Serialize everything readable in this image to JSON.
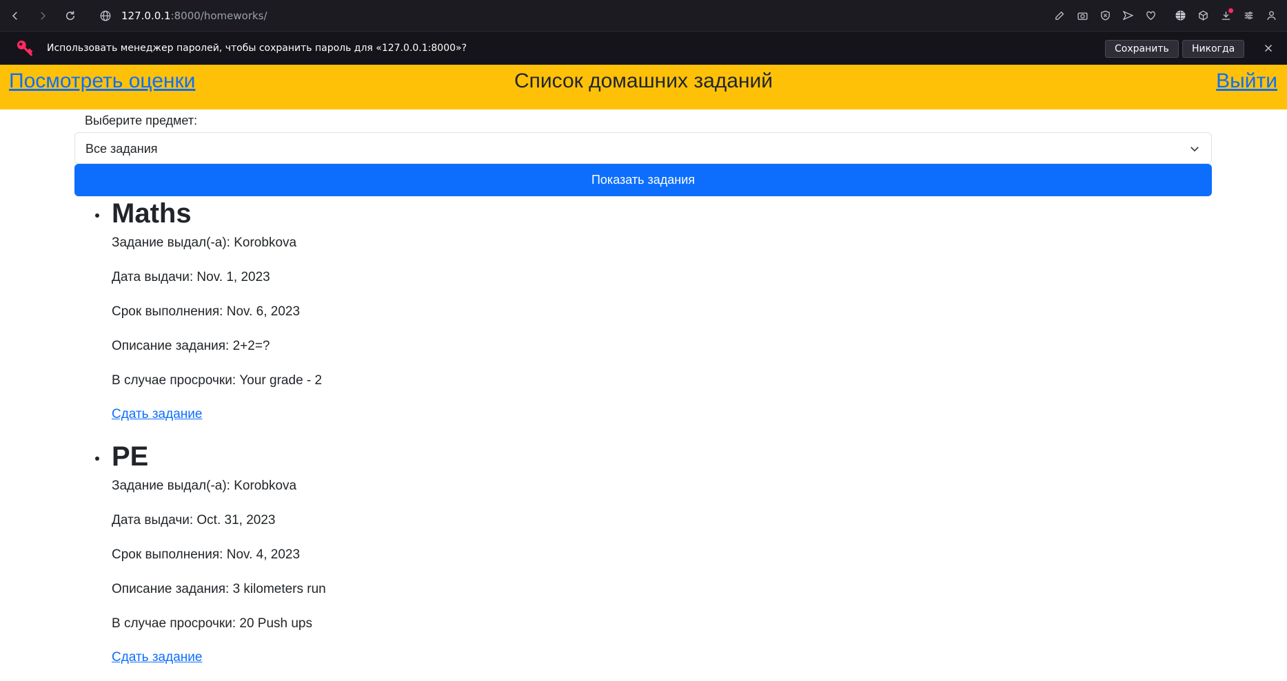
{
  "browser": {
    "url_host": "127.0.0.1",
    "url_rest": ":8000/homeworks/"
  },
  "password_bar": {
    "message": "Использовать менеджер паролей, чтобы сохранить пароль для «127.0.0.1:8000»?",
    "save_label": "Сохранить",
    "never_label": "Никогда"
  },
  "header": {
    "left_link": "Посмотреть оценки",
    "title": "Список домашних заданий",
    "right_link": "Выйти"
  },
  "form": {
    "label": "Выберите предмет:",
    "selected": "Все задания",
    "submit_label": "Показать задания"
  },
  "homeworks": [
    {
      "subject": "Maths",
      "issued_by": "Задание выдал(-а): Korobkova",
      "issued_date": "Дата выдачи: Nov. 1, 2023",
      "due_date": "Срок выполнения: Nov. 6, 2023",
      "description": "Описание задания: 2+2=?",
      "penalty": "В случае просрочки: Your grade - 2",
      "submit_link": "Сдать задание"
    },
    {
      "subject": "PE",
      "issued_by": "Задание выдал(-а): Korobkova",
      "issued_date": "Дата выдачи: Oct. 31, 2023",
      "due_date": "Срок выполнения: Nov. 4, 2023",
      "description": "Описание задания: 3 kilometers run",
      "penalty": "В случае просрочки: 20 Push ups",
      "submit_link": "Сдать задание"
    }
  ],
  "colors": {
    "header_bg": "#ffc107",
    "link": "#0d6efd",
    "button": "#0d6efd",
    "chrome_bg": "#1c1b22"
  }
}
